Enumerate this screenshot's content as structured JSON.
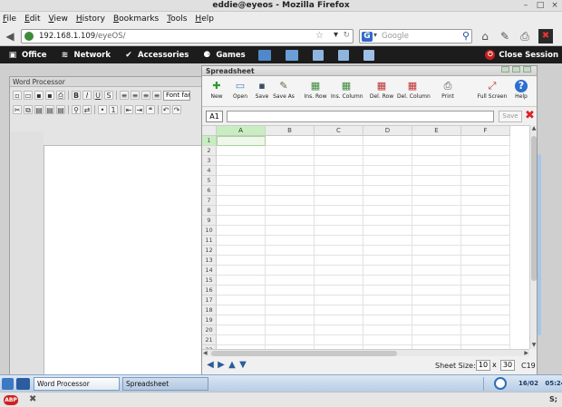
{
  "window": {
    "title": "eddie@eyeos - Mozilla Firefox"
  },
  "menu": {
    "items": [
      "File",
      "Edit",
      "View",
      "History",
      "Bookmarks",
      "Tools",
      "Help"
    ]
  },
  "nav": {
    "url_host": "192.168.1.109",
    "url_path": "/eyeOS/",
    "search_placeholder": "Google",
    "search_engine_letter": "G"
  },
  "eyeos_bar": {
    "items": [
      {
        "label": "Office",
        "icon": "briefcase-icon"
      },
      {
        "label": "Network",
        "icon": "network-icon"
      },
      {
        "label": "Accessories",
        "icon": "check-circle-icon"
      },
      {
        "label": "Games",
        "icon": "gamepad-icon"
      }
    ],
    "close_session": "Close Session"
  },
  "word_processor": {
    "title": "Word Processor",
    "font_select": "Font fam"
  },
  "spreadsheet": {
    "title": "Spreadsheet",
    "toolbar": [
      {
        "label": "New",
        "icon": "new-icon",
        "color": "#2e9a2e"
      },
      {
        "label": "Open",
        "icon": "open-icon",
        "color": "#4a7fc0"
      },
      {
        "label": "Save",
        "icon": "save-icon",
        "color": "#3a4e66"
      },
      {
        "label": "Save As",
        "icon": "save-as-icon",
        "color": "#5a6a40"
      },
      {
        "label": "Ins. Row",
        "icon": "insert-row-icon",
        "color": "#3f8a3f"
      },
      {
        "label": "Ins. Column",
        "icon": "insert-column-icon",
        "color": "#3f8a3f"
      },
      {
        "label": "Del. Row",
        "icon": "delete-row-icon",
        "color": "#c03030"
      },
      {
        "label": "Del. Column",
        "icon": "delete-column-icon",
        "color": "#c03030"
      },
      {
        "label": "Print",
        "icon": "print-icon",
        "color": "#555555"
      },
      {
        "label": "Full Screen",
        "icon": "fullscreen-icon",
        "color": "#c03030"
      },
      {
        "label": "Help",
        "icon": "help-icon",
        "color": "#2d6fd0"
      }
    ],
    "cell_ref": "A1",
    "save_label": "Save",
    "columns": [
      "A",
      "B",
      "C",
      "D",
      "E",
      "F"
    ],
    "rows": [
      "1",
      "2",
      "3",
      "4",
      "5",
      "6",
      "7",
      "8",
      "9",
      "10",
      "11",
      "12",
      "13",
      "14",
      "15",
      "16",
      "17",
      "18",
      "19",
      "20",
      "21",
      "22"
    ],
    "sheet_size_label": "Sheet Size:",
    "sheet_rows": "10",
    "sheet_x": "x",
    "sheet_cols": "30",
    "footer_ref": "C19"
  },
  "taskbar": {
    "tasks": [
      "Word Processor",
      "Spreadsheet"
    ],
    "date": "16/02",
    "time": "05:24"
  },
  "status": {
    "abp": "ABP",
    "right": "S;"
  }
}
